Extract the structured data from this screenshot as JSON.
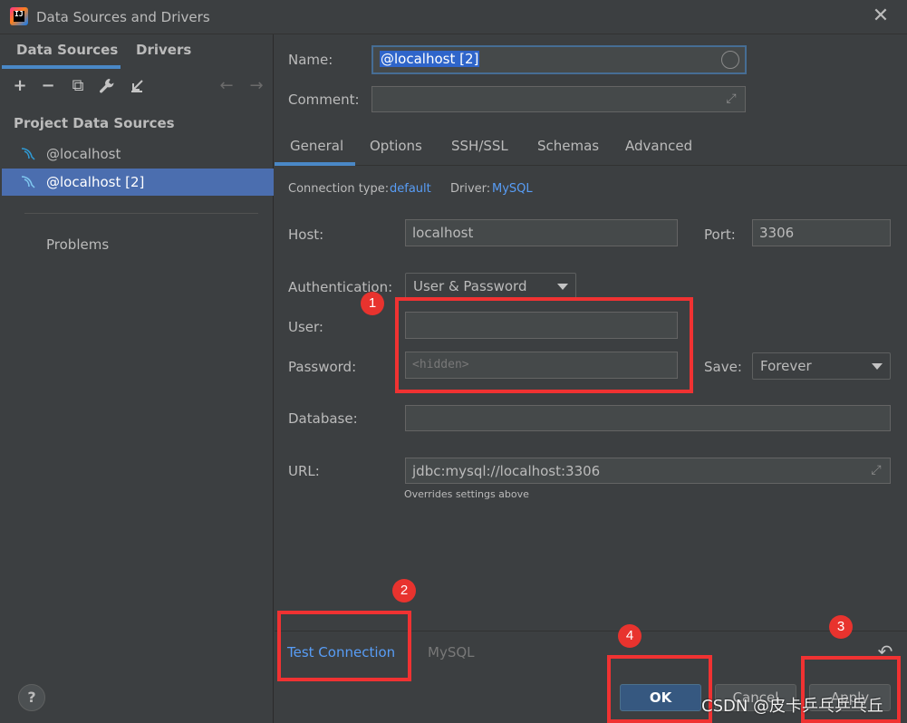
{
  "window": {
    "title": "Data Sources and Drivers",
    "close_glyph": "✕"
  },
  "left_panel": {
    "tabs": [
      {
        "label": "Data Sources",
        "active": true
      },
      {
        "label": "Drivers",
        "active": false
      }
    ],
    "toolbar": {
      "add": "+",
      "remove": "−",
      "copy": "⧉",
      "wrench": "🔧",
      "import": "⇲",
      "back": "←",
      "forward": "→"
    },
    "section_label": "Project Data Sources",
    "items": [
      {
        "label": "@localhost",
        "selected": false
      },
      {
        "label": "@localhost [2]",
        "selected": true
      }
    ],
    "problems_label": "Problems"
  },
  "form": {
    "name_label": "Name:",
    "name_value": "@localhost [2]",
    "comment_label": "Comment:",
    "comment_value": "",
    "tabs": [
      {
        "label": "General",
        "active": true
      },
      {
        "label": "Options",
        "active": false
      },
      {
        "label": "SSH/SSL",
        "active": false
      },
      {
        "label": "Schemas",
        "active": false
      },
      {
        "label": "Advanced",
        "active": false
      }
    ],
    "connection_type_label": "Connection type:",
    "connection_type_value": "default",
    "driver_label": "Driver:",
    "driver_value": "MySQL",
    "host_label": "Host:",
    "host_value": "localhost",
    "port_label": "Port:",
    "port_value": "3306",
    "auth_label": "Authentication:",
    "auth_value": "User & Password",
    "user_label": "User:",
    "user_value": "",
    "password_label": "Password:",
    "password_placeholder": "<hidden>",
    "save_label": "Save:",
    "save_value": "Forever",
    "database_label": "Database:",
    "database_value": "",
    "url_label": "URL:",
    "url_value": "jdbc:mysql://localhost:3306",
    "url_hint": "Overrides settings above"
  },
  "footer": {
    "test_connection": "Test Connection",
    "driver_link": "MySQL",
    "revert_glyph": "↶",
    "help": "?",
    "ok": "OK",
    "cancel": "Cancel",
    "apply": "Apply"
  },
  "annotations": {
    "badges": [
      "1",
      "2",
      "3",
      "4"
    ],
    "watermark": "CSDN @皮卡乒乓乒乓丘"
  },
  "colors": {
    "accent": "#4a88c7",
    "link": "#589df6",
    "selection": "#4b6eaf",
    "annotation_red": "#f03232"
  }
}
